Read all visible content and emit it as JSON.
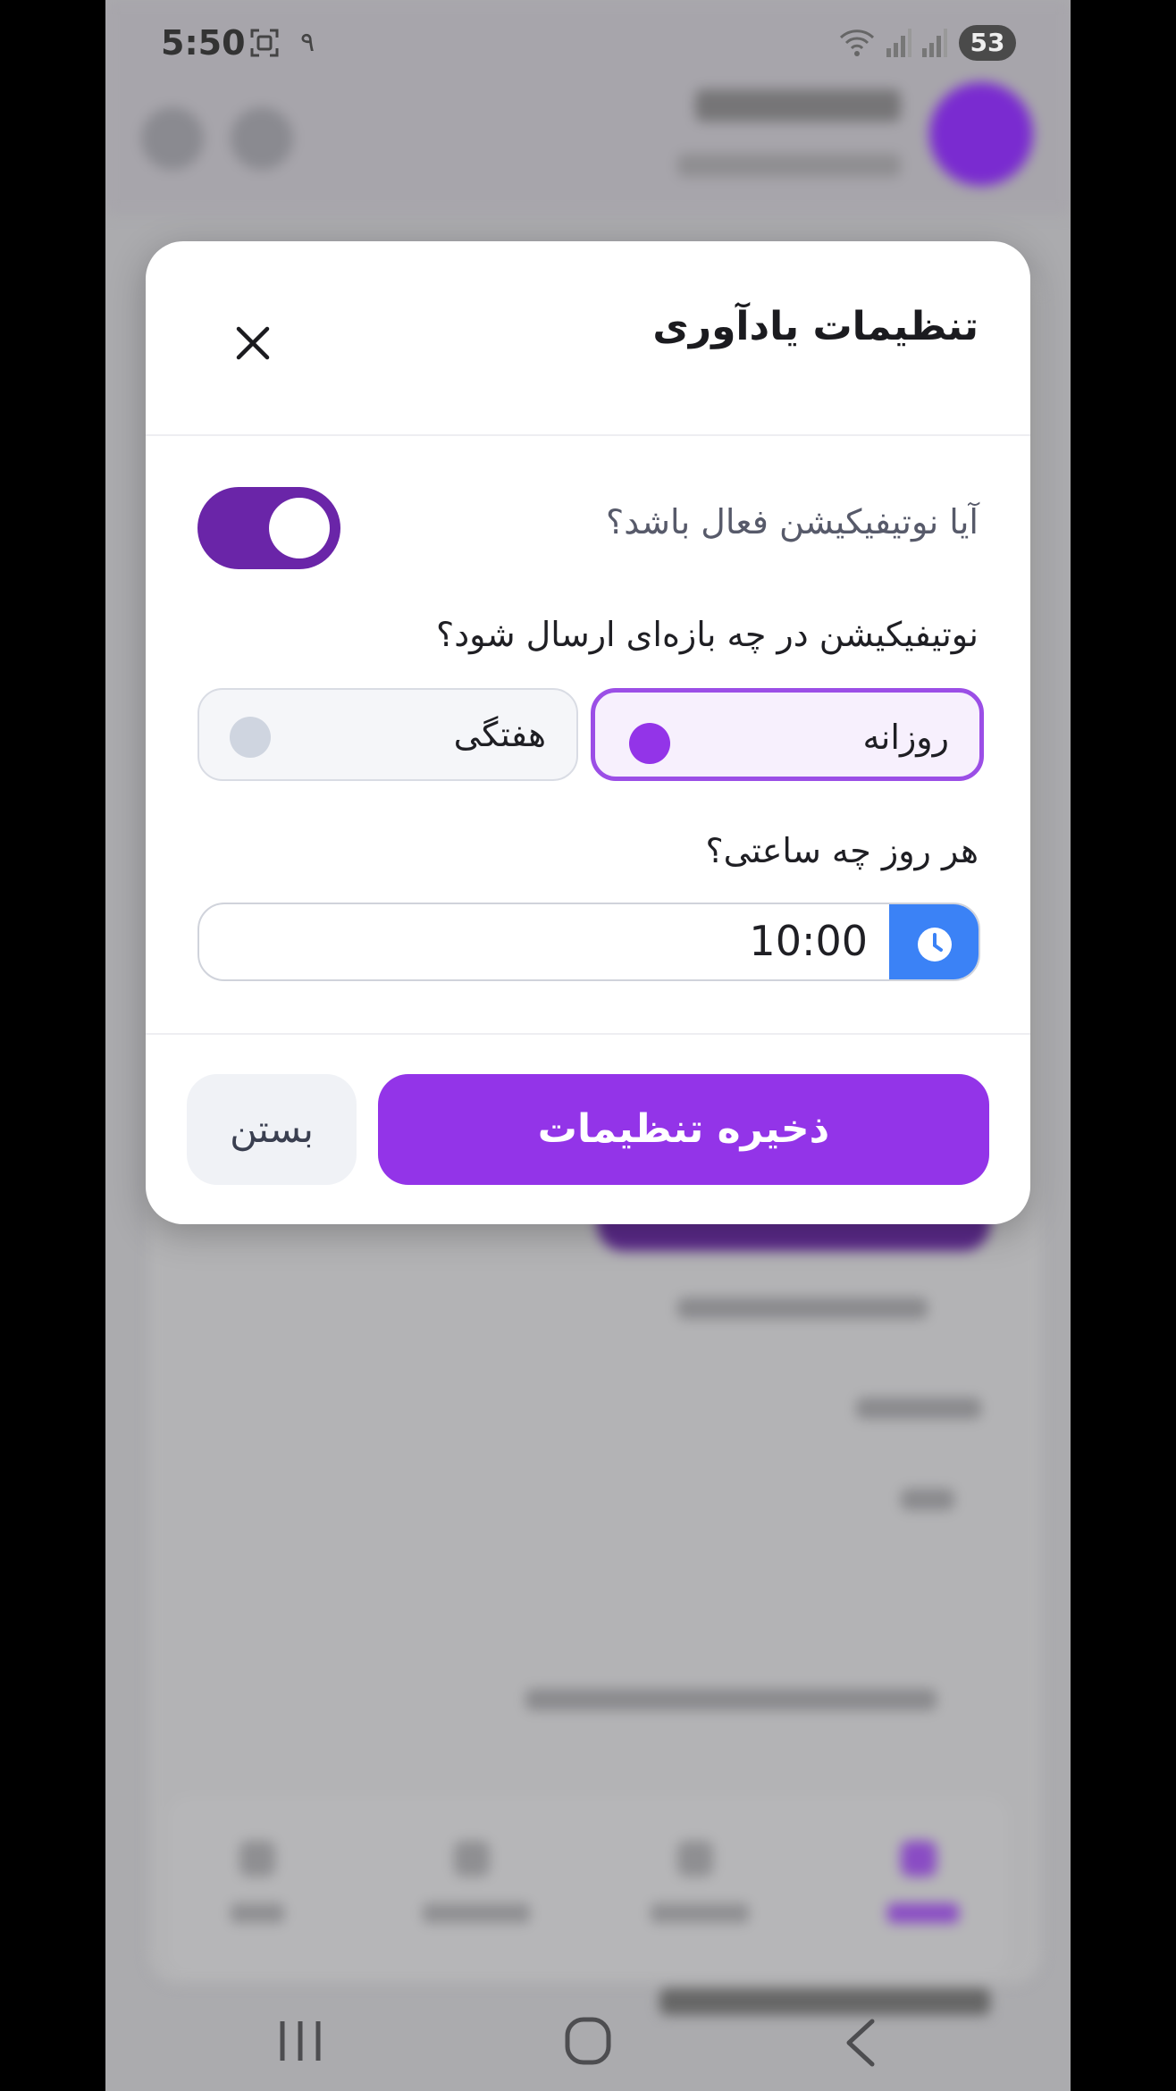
{
  "status_bar": {
    "time": "5:50",
    "notif_digit": "٩",
    "battery": "53"
  },
  "dialog": {
    "title": "تنظیمات یادآوری",
    "notification_question": "آیا نوتیفیکیشن فعال باشد؟",
    "notification_enabled": true,
    "interval_question": "نوتیفیکیشن در چه بازه‌ای ارسال شود؟",
    "options": [
      {
        "label": "روزانه",
        "selected": true
      },
      {
        "label": "هفتگی",
        "selected": false
      }
    ],
    "time_question": "هر روز چه ساعتی؟",
    "time_value": "10:00",
    "save_label": "ذخیره تنظیمات",
    "close_label": "بستن"
  },
  "colors": {
    "accent": "#9334e8",
    "toggle_on": "#6a25a8",
    "time_button": "#3b82f6"
  },
  "icons": {
    "close": "close-icon",
    "clock": "clock-icon",
    "wifi": "wifi-icon",
    "signal": "signal-icon"
  }
}
